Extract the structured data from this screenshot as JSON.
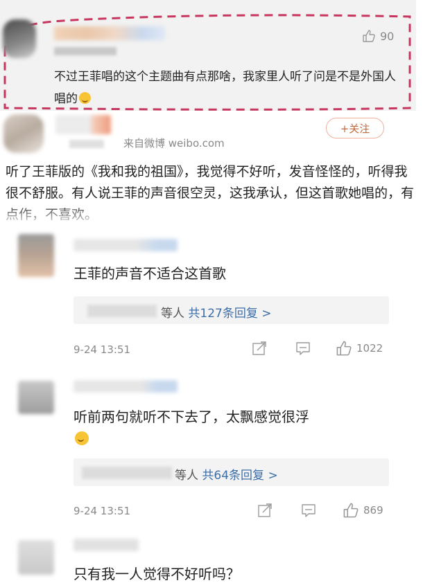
{
  "top_comment": {
    "like_count": "90",
    "text": "不过王菲唱的这个主题曲有点那啥，我家里人听了问是不是外国人唱的"
  },
  "post": {
    "source": "来自微博 weibo.com",
    "follow_label": "+关注",
    "text": "听了王菲版的《我和我的祖国》，我觉得不好听，发音怪怪的，听得我很不舒服。有人说王菲的声音很空灵，这我承认，但这首歌她唱的，有点作，不喜欢。"
  },
  "replies": [
    {
      "text": "王菲的声音不适合这首歌",
      "sub_prefix": "等人",
      "sub_count": "共127条回复",
      "sub_arrow": ">",
      "time": "9-24 13:51",
      "likes": "1022"
    },
    {
      "text": "听前两句就听不下去了，太飘感觉很浮",
      "sub_prefix": "等人",
      "sub_count": "共64条回复",
      "sub_arrow": ">",
      "time": "9-24 13:51",
      "likes": "869"
    },
    {
      "text": "只有我一人觉得不好听吗？"
    }
  ],
  "icons": {
    "like": "thumbs-up-icon",
    "share": "share-icon",
    "comment": "comment-icon",
    "emoji": "laughing-emoji-icon"
  },
  "colors": {
    "dash": "#c7365f",
    "follow": "#c06a3a",
    "link": "#3c6ea8"
  }
}
